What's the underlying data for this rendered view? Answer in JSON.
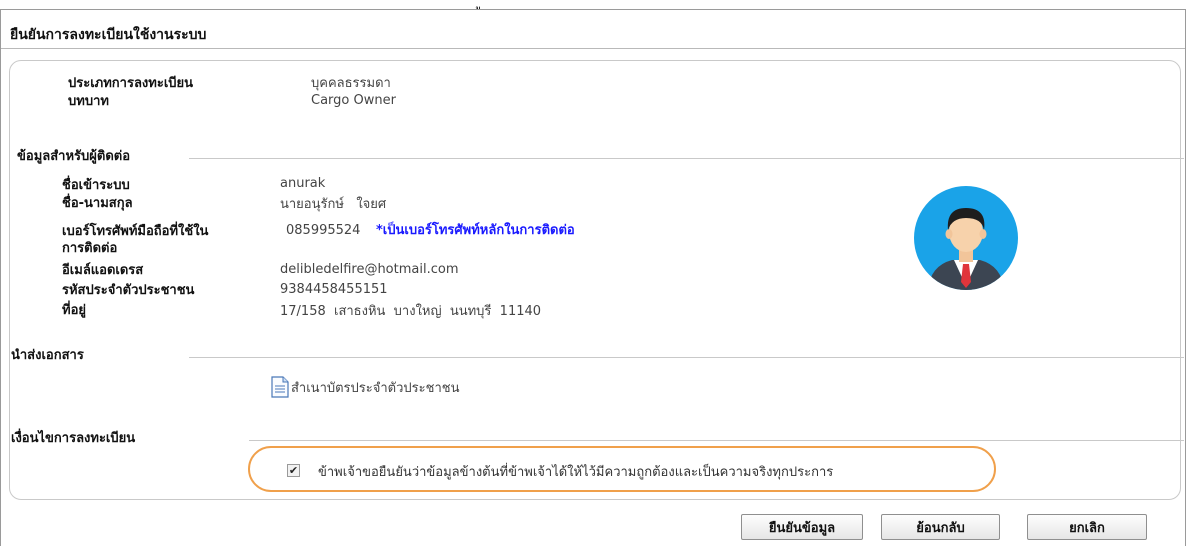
{
  "header": {
    "mark": "ู",
    "title": "ยืนยันการลงทะเบียนใช้งานระบบ"
  },
  "registration": {
    "type_label": "ประเภทการลงทะเบียน",
    "type_value": "บุคคลธรรมดา",
    "role_label": "บทบาท",
    "role_value": "Cargo Owner"
  },
  "contact": {
    "section_title": "ข้อมูลสำหรับผู้ติดต่อ",
    "username_label": "ชื่อเข้าระบบ",
    "username_value": "anurak",
    "fullname_label": "ชื่อ-นามสกุล",
    "fullname_value": "นายอนุรักษ์   ใจยศ",
    "phone_label_line1": "เบอร์โทรศัพท์มือถือที่ใช้ใน",
    "phone_label_line2": "การติดต่อ",
    "phone_value": "085995524",
    "phone_note": "*เป็นเบอร์โทรศัพท์หลักในการติดต่อ",
    "email_label": "อีเมล์แอดเดรส",
    "email_value": "delibledelfire@hotmail.com",
    "id_label": "รหัสประจำตัวประชาชน",
    "id_value": "9384458455151",
    "address_label": "ที่อยู่",
    "address_value": "17/158  เสาธงหิน  บางใหญ่  นนทบุรี  11140"
  },
  "documents": {
    "section_title": "นำส่งเอกสาร",
    "items": [
      {
        "label": "สำเนาบัตรประจำตัวประชาชน",
        "icon": "document-icon"
      }
    ]
  },
  "terms": {
    "section_title": "เงื่อนไขการลงทะเบียน",
    "checkbox_checked": true,
    "checkbox_mark": "✔",
    "consent_text": "ข้าพเจ้าขอยืนยันว่าข้อมูลข้างต้นที่ข้าพเจ้าได้ให้ไว้มีความถูกต้องและเป็นความจริงทุกประการ"
  },
  "actions": {
    "confirm_label": "ยืนยันข้อมูล",
    "back_label": "ย้อนกลับ",
    "cancel_label": "ยกเลิก"
  },
  "colors": {
    "highlight_border": "#f0a04b",
    "phone_note": "#1a1aff",
    "avatar_bg": "#1aa3e8"
  },
  "avatar_icon": "user-avatar-icon"
}
